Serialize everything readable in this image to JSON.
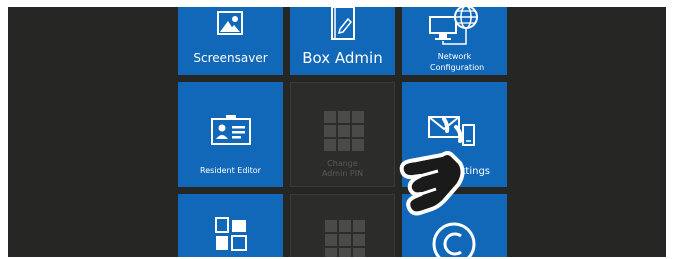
{
  "tiles": {
    "screensaver": {
      "label": "Screensaver"
    },
    "box_admin": {
      "label": "Box Admin"
    },
    "network_configuration": {
      "label": "Network Configuration"
    },
    "resident_editor": {
      "label": "Resident Editor"
    },
    "change_admin_pin": {
      "label": "Change Admin PIN",
      "state": "disabled"
    },
    "settings": {
      "label": "Settings"
    },
    "windows_tile": {
      "label": ""
    },
    "disabled_keypad_tile": {
      "label": "",
      "state": "disabled"
    },
    "copyright_tile": {
      "label": ""
    }
  },
  "icons": {
    "screensaver": "picture-icon",
    "box_admin": "edit-document-icon",
    "network_configuration": "monitor-globe-icon",
    "resident_editor": "id-card-icon",
    "change_admin_pin": "keypad-icon",
    "settings": "mail-phone-icon",
    "windows_tile": "windows-icon",
    "disabled_keypad_tile": "keypad-icon",
    "copyright_tile": "copyright-icon",
    "overlay": "tap-hand-icon"
  },
  "colors": {
    "tile_blue": "#1168b8",
    "background": "#262625",
    "disabled_tile": "#2c2c2b"
  }
}
